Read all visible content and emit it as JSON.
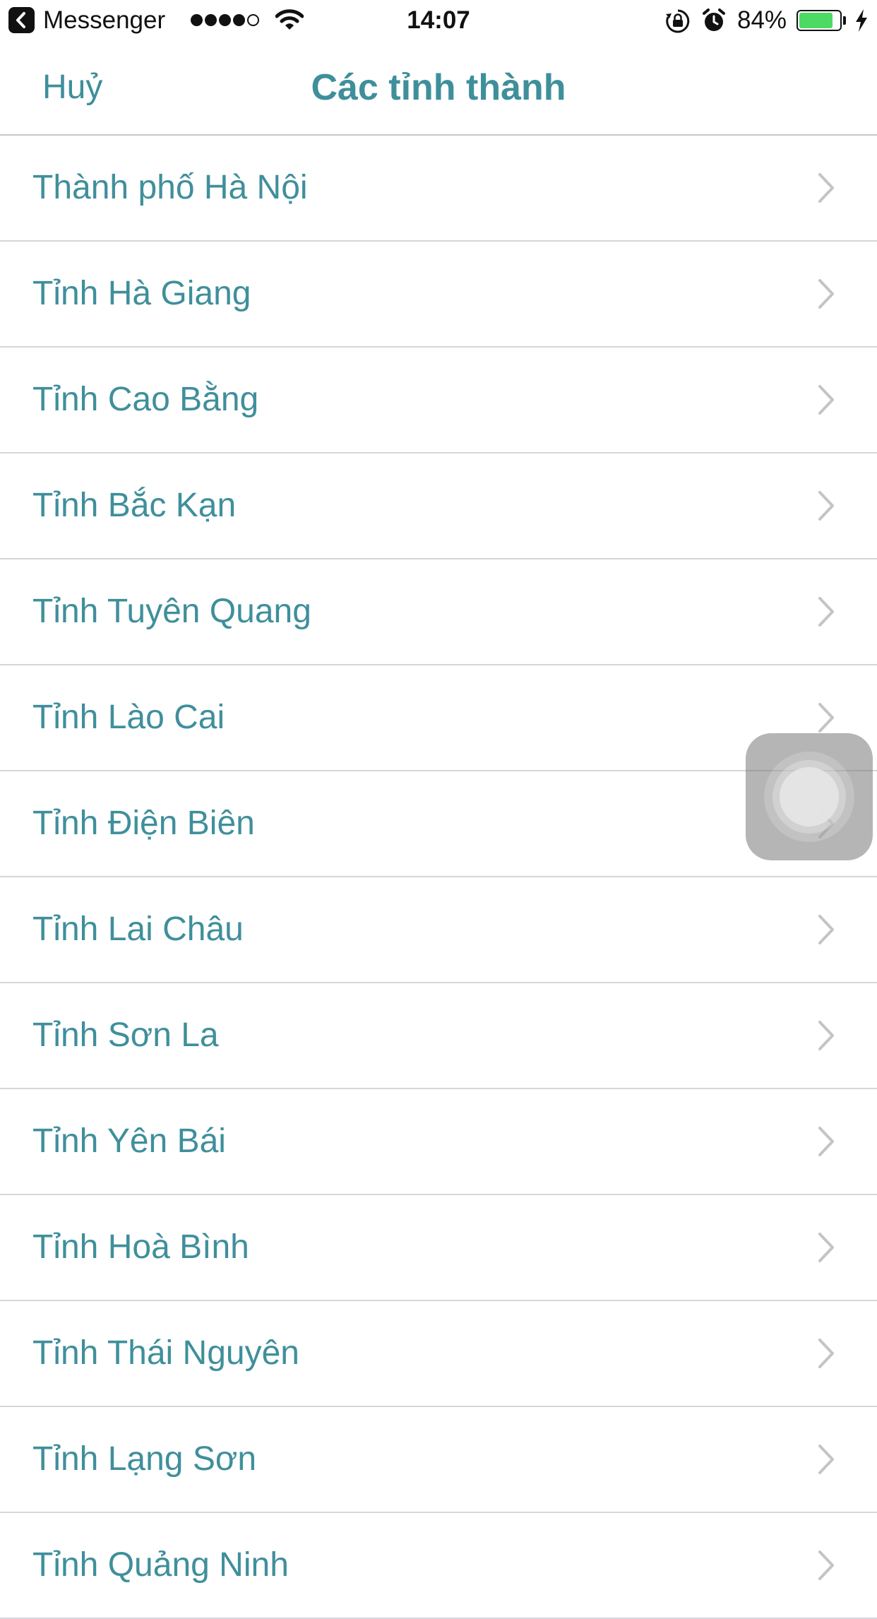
{
  "status_bar": {
    "back_app": "Messenger",
    "time": "14:07",
    "battery_percent": "84%",
    "battery_level": 0.84,
    "signal_bars_filled": 4,
    "signal_bars_total": 5,
    "icons": [
      "back-icon",
      "wifi-icon",
      "orientation-lock-icon",
      "alarm-icon",
      "battery-icon",
      "charging-bolt-icon"
    ]
  },
  "nav": {
    "cancel_label": "Huỷ",
    "title": "Các tỉnh thành"
  },
  "colors": {
    "accent": "#3f8f9b",
    "separator": "#d6d6da",
    "battery": "#4cd964"
  },
  "provinces": [
    "Thành phố Hà Nội",
    "Tỉnh Hà Giang",
    "Tỉnh Cao Bằng",
    "Tỉnh Bắc Kạn",
    "Tỉnh Tuyên Quang",
    "Tỉnh Lào Cai",
    "Tỉnh Điện Biên",
    "Tỉnh Lai Châu",
    "Tỉnh Sơn La",
    "Tỉnh Yên Bái",
    "Tỉnh Hoà Bình",
    "Tỉnh Thái Nguyên",
    "Tỉnh Lạng Sơn",
    "Tỉnh Quảng Ninh"
  ]
}
